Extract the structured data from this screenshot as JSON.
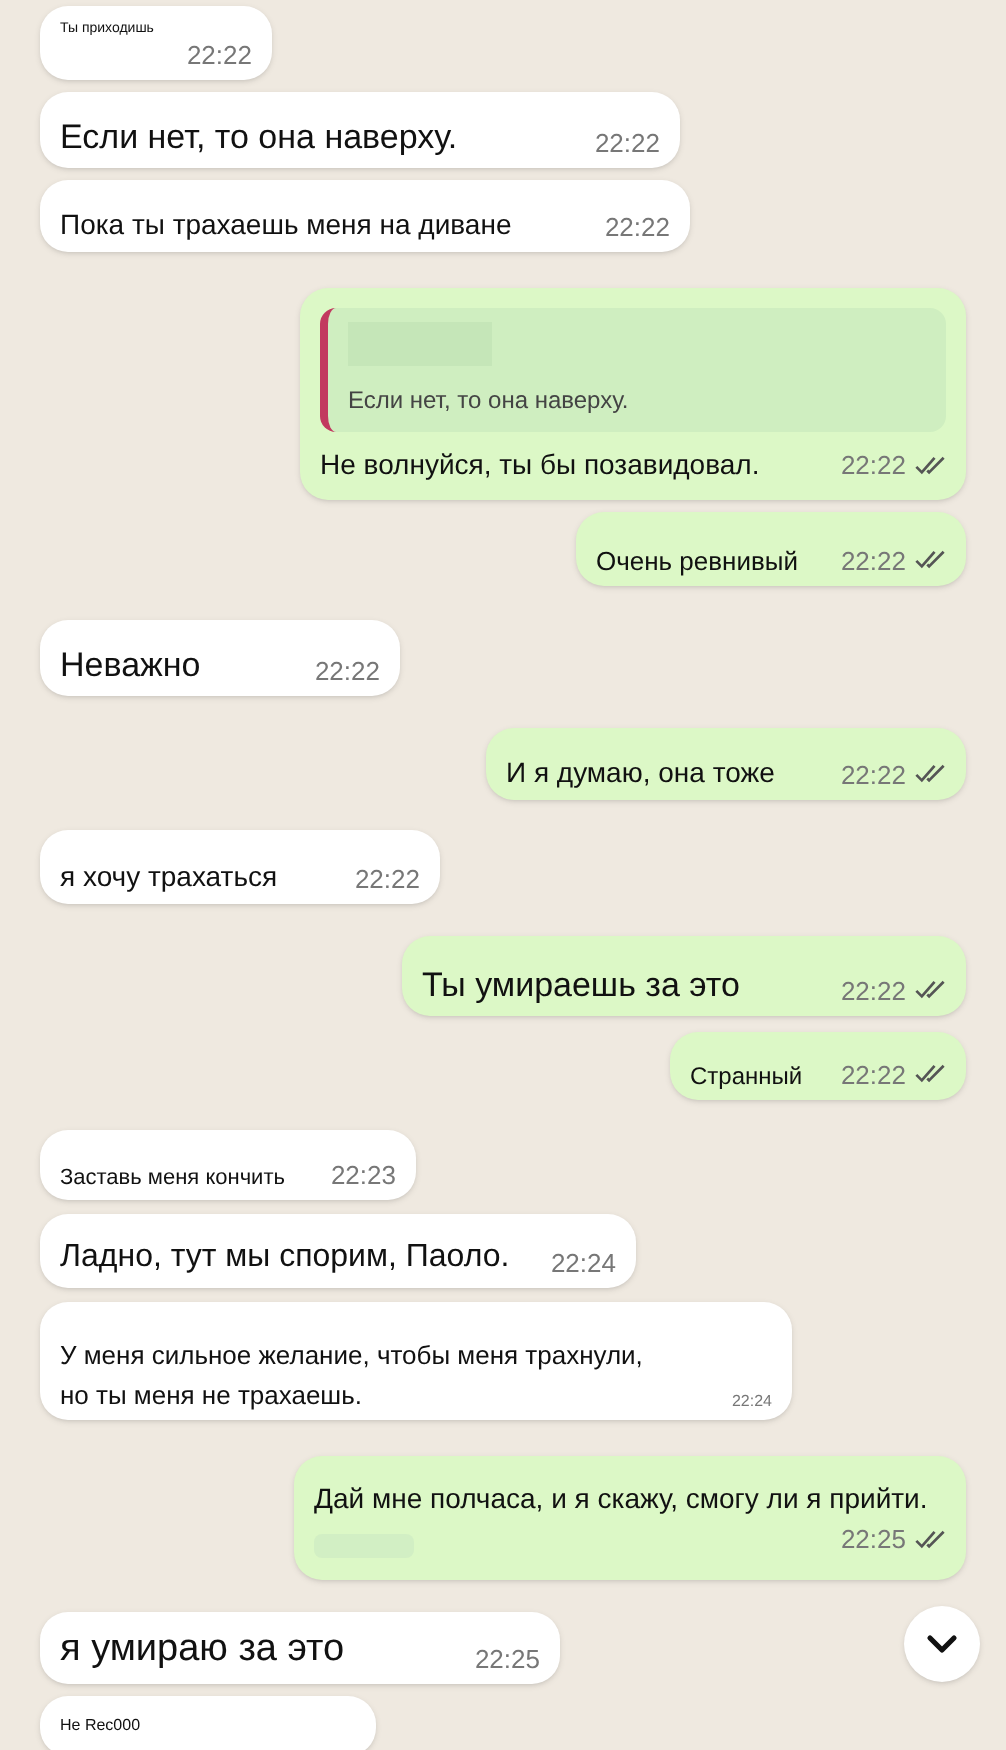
{
  "messages": [
    {
      "outgoing": false,
      "text": "Ты приходишь",
      "time": "22:22"
    },
    {
      "outgoing": false,
      "text": "Если нет, то она наверху.",
      "time": "22:22"
    },
    {
      "outgoing": false,
      "text": "Пока ты трахаешь меня на диване",
      "time": "22:22"
    },
    {
      "outgoing": true,
      "reply": {
        "text": "Если нет, то она наверху."
      },
      "text": "Не волнуйся, ты бы позавидовал.",
      "time": "22:22",
      "read": false
    },
    {
      "outgoing": true,
      "text": "Очень ревнивый",
      "time": "22:22",
      "read": false
    },
    {
      "outgoing": false,
      "text": "Неважно",
      "time": "22:22"
    },
    {
      "outgoing": true,
      "text": "И я думаю, она тоже",
      "time": "22:22",
      "read": false
    },
    {
      "outgoing": false,
      "text": "я хочу трахаться",
      "time": "22:22"
    },
    {
      "outgoing": true,
      "text": "Ты умираешь за это",
      "time": "22:22",
      "read": false
    },
    {
      "outgoing": true,
      "text": "Странный",
      "time": "22:22",
      "read": false
    },
    {
      "outgoing": false,
      "text": "Заставь меня кончить",
      "time": "22:23"
    },
    {
      "outgoing": false,
      "text": "Ладно, тут мы спорим, Паоло.",
      "time": "22:24"
    },
    {
      "outgoing": false,
      "text": "У меня сильное желание, чтобы меня трахнули, но ты меня не трахаешь.",
      "time": "22:24"
    },
    {
      "outgoing": true,
      "text": "Дай мне полчаса, и я скажу, смогу ли я прийти.",
      "time": "22:25",
      "read": false
    },
    {
      "outgoing": false,
      "text": "я умираю за это",
      "time": "22:25"
    },
    {
      "outgoing": false,
      "text": "Не Rec000"
    }
  ]
}
